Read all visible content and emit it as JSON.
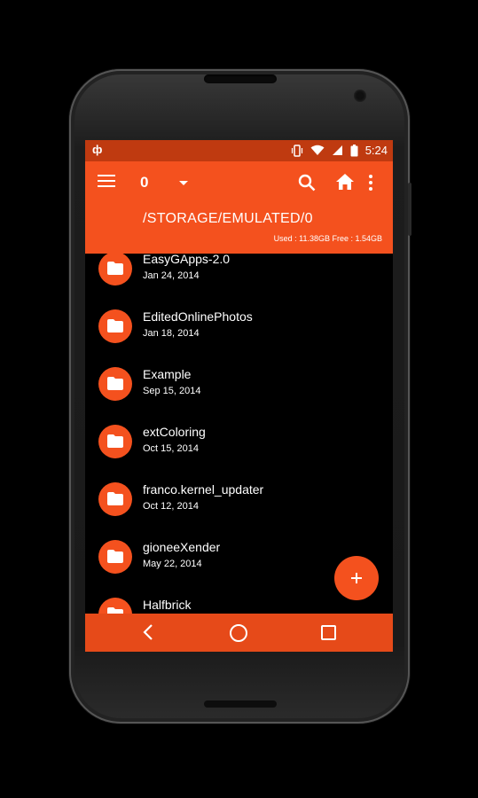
{
  "status_bar": {
    "app_icon": "notification-icon",
    "time": "5:24",
    "icons": [
      "vibrate-icon",
      "wifi-icon",
      "signal-icon",
      "battery-icon"
    ]
  },
  "toolbar": {
    "tab_count": "0",
    "path": "/STORAGE/EMULATED/0",
    "usage": "Used : 11.38GB Free : 1.54GB"
  },
  "files": [
    {
      "name": "EasyGApps-2.0",
      "date": "Jan 24, 2014"
    },
    {
      "name": "EditedOnlinePhotos",
      "date": "Jan 18, 2014"
    },
    {
      "name": "Example",
      "date": "Sep 15, 2014"
    },
    {
      "name": "extColoring",
      "date": "Oct 15, 2014"
    },
    {
      "name": "franco.kernel_updater",
      "date": "Oct 12, 2014"
    },
    {
      "name": "gioneeXender",
      "date": "May 22, 2014"
    },
    {
      "name": "Halfbrick",
      "date": ""
    }
  ],
  "colors": {
    "accent": "#f4511e",
    "status_bar": "#bf3a10",
    "nav_bar": "#e64a19",
    "background": "#000000"
  }
}
